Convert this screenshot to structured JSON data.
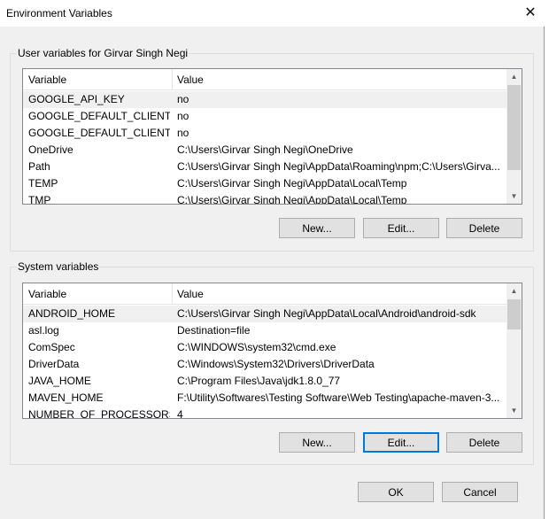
{
  "window": {
    "title": "Environment Variables",
    "close_glyph": "✕"
  },
  "user_vars": {
    "group_label": "User variables for Girvar Singh Negi",
    "columns": [
      "Variable",
      "Value"
    ],
    "rows": [
      {
        "name": "GOOGLE_API_KEY",
        "value": "no",
        "selected": true
      },
      {
        "name": "GOOGLE_DEFAULT_CLIENT_ID",
        "value": "no"
      },
      {
        "name": "GOOGLE_DEFAULT_CLIENT_S...",
        "value": "no"
      },
      {
        "name": "OneDrive",
        "value": "C:\\Users\\Girvar Singh Negi\\OneDrive"
      },
      {
        "name": "Path",
        "value": "C:\\Users\\Girvar Singh Negi\\AppData\\Roaming\\npm;C:\\Users\\Girva..."
      },
      {
        "name": "TEMP",
        "value": "C:\\Users\\Girvar Singh Negi\\AppData\\Local\\Temp"
      },
      {
        "name": "TMP",
        "value": "C:\\Users\\Girvar Singh Negi\\AppData\\Local\\Temp"
      }
    ],
    "buttons": {
      "new": "New...",
      "edit": "Edit...",
      "delete": "Delete"
    }
  },
  "system_vars": {
    "group_label": "System variables",
    "columns": [
      "Variable",
      "Value"
    ],
    "rows": [
      {
        "name": "ANDROID_HOME",
        "value": "C:\\Users\\Girvar Singh Negi\\AppData\\Local\\Android\\android-sdk",
        "selected": true
      },
      {
        "name": "asl.log",
        "value": "Destination=file"
      },
      {
        "name": "ComSpec",
        "value": "C:\\WINDOWS\\system32\\cmd.exe"
      },
      {
        "name": "DriverData",
        "value": "C:\\Windows\\System32\\Drivers\\DriverData"
      },
      {
        "name": "JAVA_HOME",
        "value": "C:\\Program Files\\Java\\jdk1.8.0_77"
      },
      {
        "name": "MAVEN_HOME",
        "value": "F:\\Utility\\Softwares\\Testing Software\\Web Testing\\apache-maven-3..."
      },
      {
        "name": "NUMBER_OF_PROCESSORS",
        "value": "4"
      }
    ],
    "buttons": {
      "new": "New...",
      "edit": "Edit...",
      "delete": "Delete"
    }
  },
  "footer": {
    "ok": "OK",
    "cancel": "Cancel"
  },
  "scrollbar": {
    "up_glyph": "▲",
    "down_glyph": "▼"
  },
  "colors": {
    "focus_border": "#0078d7",
    "button_face": "#e1e1e1",
    "dialog_bg": "#f0f0f0"
  }
}
